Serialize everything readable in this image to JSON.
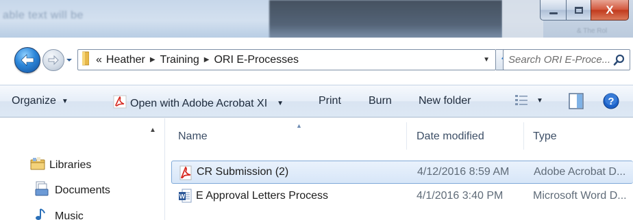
{
  "window": {
    "background_title_text": "able text will be",
    "ghost_text_left": "& The Rol",
    "close_label": "X"
  },
  "address_bar": {
    "overflow_chevron": "«",
    "breadcrumbs": [
      "Heather",
      "Training",
      "ORI E-Processes"
    ],
    "search_placeholder": "Search ORI E-Proce..."
  },
  "command_bar": {
    "organize": "Organize",
    "open_with": "Open with Adobe Acrobat XI",
    "print": "Print",
    "burn": "Burn",
    "new_folder": "New folder"
  },
  "nav_pane": {
    "items": [
      {
        "label": "Libraries",
        "icon": "libraries-icon"
      },
      {
        "label": "Documents",
        "icon": "documents-icon"
      },
      {
        "label": "Music",
        "icon": "music-icon"
      }
    ]
  },
  "file_list": {
    "columns": {
      "name": "Name",
      "date": "Date modified",
      "type": "Type"
    },
    "rows": [
      {
        "name": "CR Submission (2)",
        "date": "4/12/2016 8:59 AM",
        "type": "Adobe Acrobat D...",
        "icon": "pdf-file-icon",
        "selected": true
      },
      {
        "name": "E Approval Letters Process",
        "date": "4/1/2016 3:40 PM",
        "type": "Microsoft Word D...",
        "icon": "word-file-icon",
        "selected": false
      }
    ]
  },
  "colors": {
    "accent_blue": "#2c86d9",
    "selection_border": "#7fa9d8",
    "close_red": "#c0391c",
    "pdf_red": "#d6281f",
    "word_blue": "#2b5797",
    "help_blue": "#1c62c9"
  }
}
